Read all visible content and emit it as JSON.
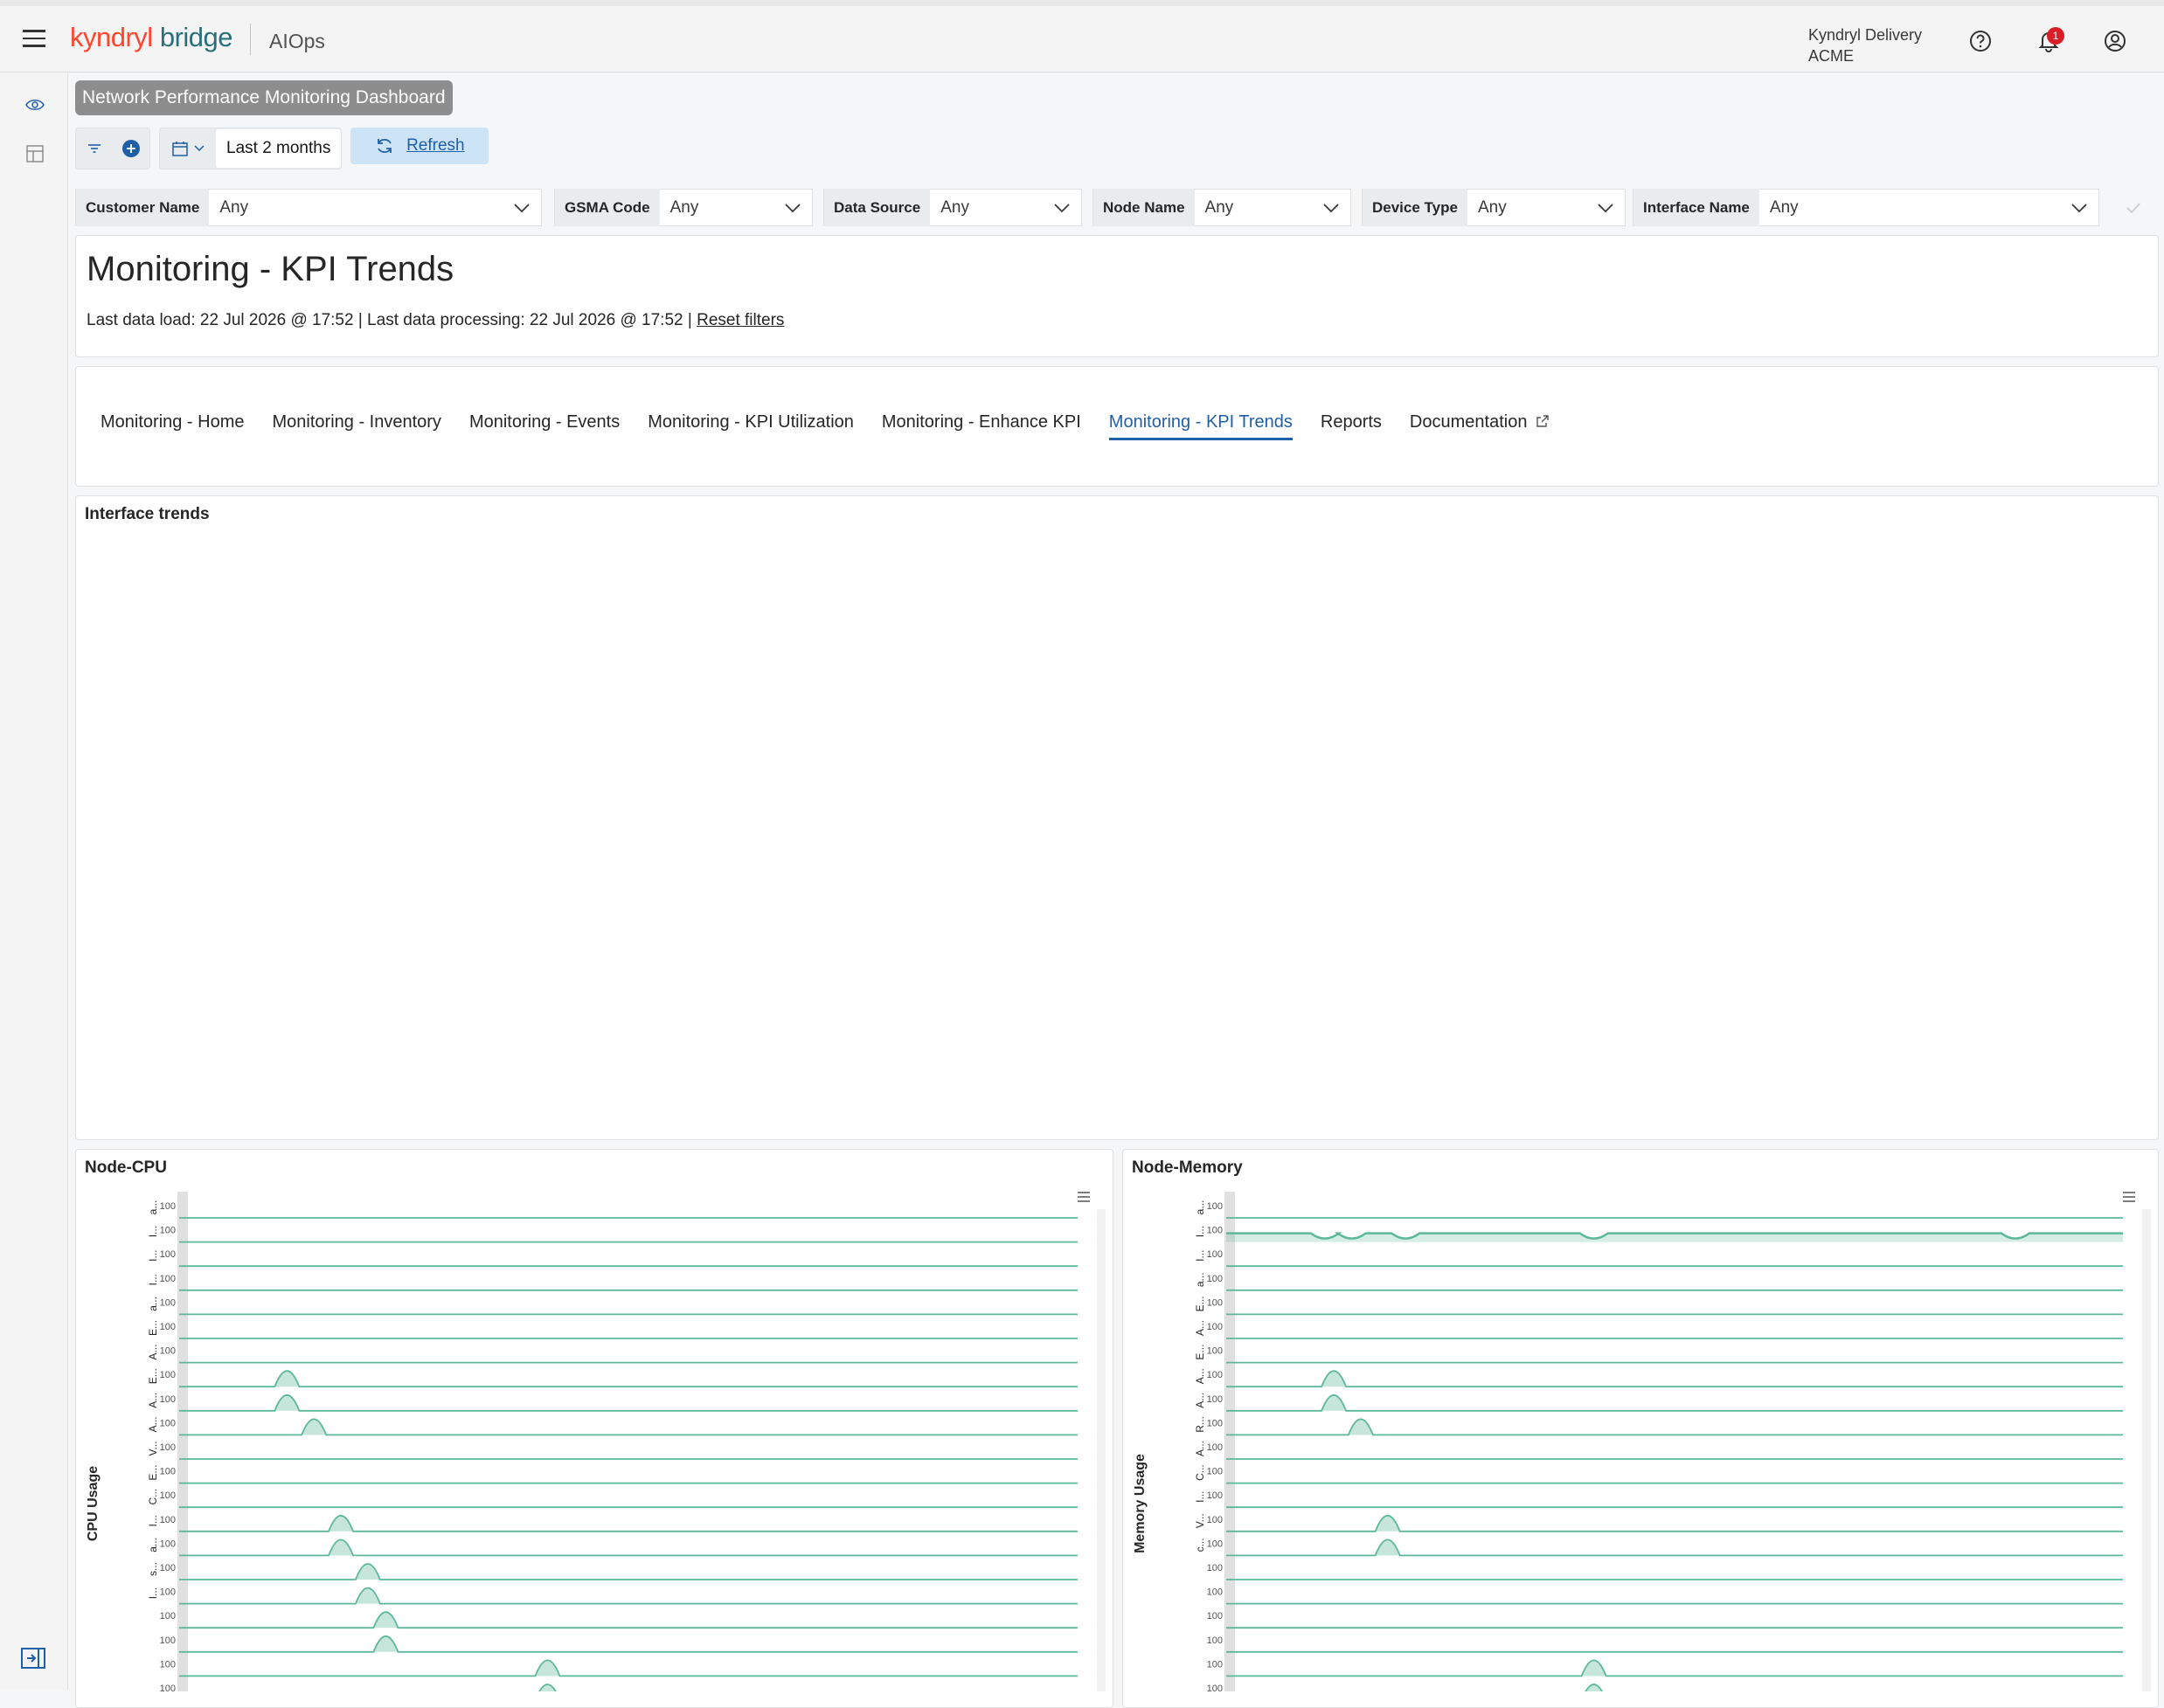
{
  "header": {
    "logo_part1": "kyndryl",
    "logo_part2": "bridge",
    "app_name": "AIOps",
    "org_line1": "Kyndryl Delivery",
    "org_line2": "ACME",
    "notification_count": "1",
    "brand_color": "#ff462d",
    "brand_color_2": "#29707a"
  },
  "dashboard": {
    "tooltip_title": "Network Performance Monitoring Dashboard"
  },
  "filterbar": {
    "range_label": "Last 2 months",
    "refresh_label": "Refresh"
  },
  "controls": [
    {
      "label": "Customer Name",
      "value": "Any"
    },
    {
      "label": "GSMA Code",
      "value": "Any"
    },
    {
      "label": "Data Source",
      "value": "Any"
    },
    {
      "label": "Node Name",
      "value": "Any"
    },
    {
      "label": "Device Type",
      "value": "Any"
    },
    {
      "label": "Interface Name",
      "value": "Any"
    }
  ],
  "page": {
    "title": "Monitoring - KPI Trends",
    "meta": "Last data load: 22 Jul 2026 @ 17:52 | Last data processing: 22 Jul 2026 @ 17:52 |",
    "reset_filters": "Reset filters"
  },
  "tabs": [
    {
      "label": "Monitoring - Home"
    },
    {
      "label": "Monitoring - Inventory"
    },
    {
      "label": "Monitoring - Events"
    },
    {
      "label": "Monitoring - KPI Utilization"
    },
    {
      "label": "Monitoring - Enhance KPI"
    },
    {
      "label": "Monitoring - KPI Trends",
      "active": true
    },
    {
      "label": "Reports"
    },
    {
      "label": "Documentation"
    }
  ],
  "sections": {
    "interface_trends": "Interface trends"
  },
  "chart_data": [
    {
      "type": "area",
      "title": "Node-CPU",
      "ylabel": "CPU Usage",
      "tick_label": "100",
      "row_labels": [
        "a...",
        "I...",
        "I...",
        "I...",
        "a...",
        "E...",
        "A...",
        "E...",
        "A...",
        "A...",
        "V...",
        "E...",
        "C...",
        "I...",
        "a...",
        "s...",
        "I..."
      ],
      "color": "#5cb89a",
      "series": [
        {
          "peaks": []
        },
        {
          "peaks": []
        },
        {
          "peaks": []
        },
        {
          "peaks": []
        },
        {
          "peaks": []
        },
        {
          "peaks": []
        },
        {
          "peaks": []
        },
        {
          "peaks": [
            0.12
          ]
        },
        {
          "peaks": [
            0.12
          ]
        },
        {
          "peaks": [
            0.15
          ]
        },
        {
          "peaks": []
        },
        {
          "peaks": []
        },
        {
          "peaks": []
        },
        {
          "peaks": [
            0.18
          ]
        },
        {
          "peaks": [
            0.18
          ]
        },
        {
          "peaks": [
            0.21
          ]
        },
        {
          "peaks": [
            0.21
          ]
        },
        {
          "peaks": [
            0.23
          ]
        },
        {
          "peaks": [
            0.23
          ]
        },
        {
          "peaks": [
            0.41
          ]
        },
        {
          "peaks": [
            0.41
          ]
        }
      ]
    },
    {
      "type": "area",
      "title": "Node-Memory",
      "ylabel": "Memory Usage",
      "tick_label": "100",
      "row_labels": [
        "a...",
        "I...",
        "I...",
        "a...",
        "E...",
        "A...",
        "E...",
        "A...",
        "A...",
        "R...",
        "A...",
        "C...",
        "I...",
        "V...",
        "c..."
      ],
      "color": "#5cb89a",
      "series": [
        {
          "peaks": []
        },
        {
          "peaks": [],
          "dips": [
            0.11,
            0.14,
            0.2,
            0.41,
            0.88
          ],
          "high": true
        },
        {
          "peaks": []
        },
        {
          "peaks": []
        },
        {
          "peaks": []
        },
        {
          "peaks": []
        },
        {
          "peaks": []
        },
        {
          "peaks": [
            0.12
          ]
        },
        {
          "peaks": [
            0.12
          ]
        },
        {
          "peaks": [
            0.15
          ]
        },
        {
          "peaks": []
        },
        {
          "peaks": []
        },
        {
          "peaks": []
        },
        {
          "peaks": [
            0.18
          ]
        },
        {
          "peaks": [
            0.18
          ]
        },
        {
          "peaks": []
        },
        {
          "peaks": []
        },
        {
          "peaks": []
        },
        {
          "peaks": []
        },
        {
          "peaks": [
            0.41
          ]
        },
        {
          "peaks": [
            0.41
          ]
        }
      ]
    }
  ]
}
